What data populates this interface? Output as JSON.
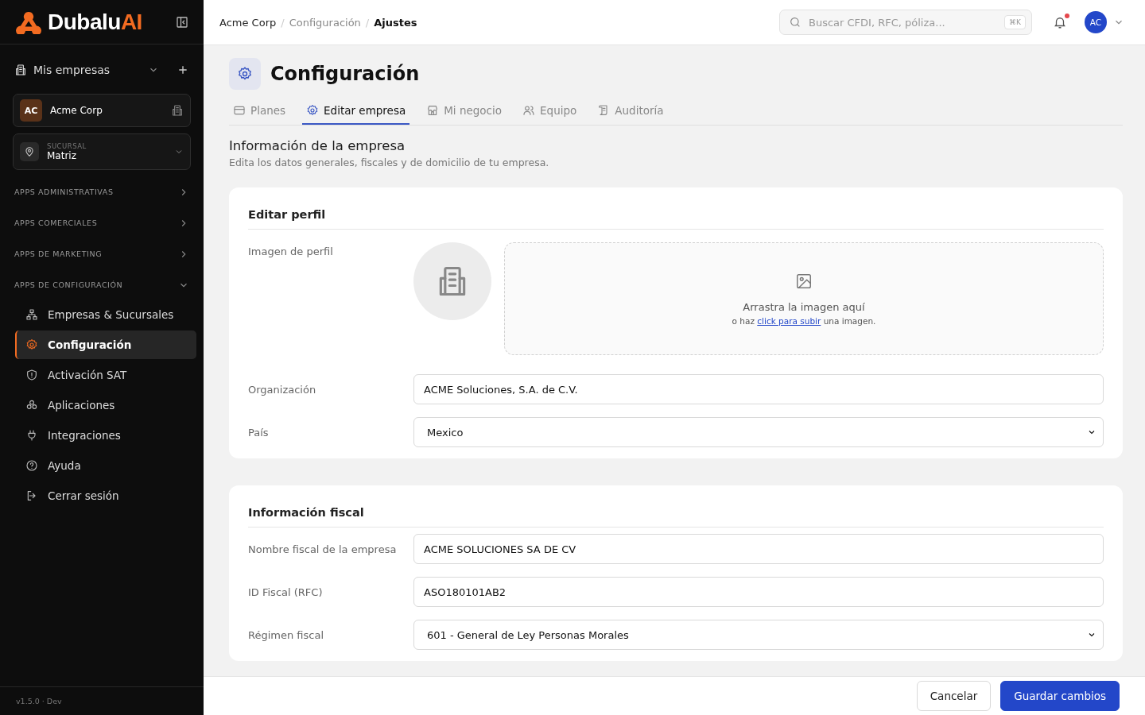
{
  "brand": {
    "name": "Dubalu",
    "accent": "AI"
  },
  "sidebar": {
    "companies_label": "Mis empresas",
    "company": {
      "initials": "AC",
      "name": "Acme Corp"
    },
    "branch": {
      "label": "SUCURSAL",
      "value": "Matriz"
    },
    "sections": [
      {
        "label": "APPS ADMINISTRATIVAS",
        "expanded": false
      },
      {
        "label": "APPS COMERCIALES",
        "expanded": false
      },
      {
        "label": "APPS DE MARKETING",
        "expanded": false
      },
      {
        "label": "APPS DE CONFIGURACIÓN",
        "expanded": true,
        "items": [
          {
            "label": "Empresas & Sucursales",
            "selected": false
          },
          {
            "label": "Configuración",
            "selected": true
          },
          {
            "label": "Activación SAT",
            "selected": false
          },
          {
            "label": "Aplicaciones",
            "selected": false
          },
          {
            "label": "Integraciones",
            "selected": false
          },
          {
            "label": "Ayuda",
            "selected": false
          },
          {
            "label": "Cerrar sesión",
            "selected": false
          }
        ]
      }
    ],
    "version": "v1.5.0 · Dev"
  },
  "breadcrumb": [
    {
      "label": "Acme Corp",
      "current": false
    },
    {
      "separator": "/"
    },
    {
      "label": "Configuración",
      "current": false
    },
    {
      "separator": "/"
    },
    {
      "label": "Ajustes",
      "current": true
    }
  ],
  "search": {
    "placeholder": "Buscar CFDI, RFC, póliza...",
    "shortcut": "⌘K"
  },
  "notifications": {
    "unread": true
  },
  "user": {
    "initials": "AC"
  },
  "page_title": "Configuración",
  "tabs": [
    {
      "label": "Planes",
      "selected": false
    },
    {
      "label": "Editar empresa",
      "selected": true
    },
    {
      "label": "Mi negocio",
      "selected": false
    },
    {
      "label": "Equipo",
      "selected": false
    },
    {
      "label": "Auditoría",
      "selected": false
    }
  ],
  "section": {
    "title": "Información de la empresa",
    "subtitle": "Edita los datos generales, fiscales y de domicilio de tu empresa."
  },
  "cards": [
    {
      "title": "Editar perfil",
      "image_label": "Imagen de perfil",
      "dropzone": {
        "title": "Arrastra la imagen aquí",
        "before": "o haz",
        "link": "click para subir",
        "after": "una imagen."
      },
      "fields": [
        {
          "label": "Organización",
          "kind": "text",
          "value": "ACME Soluciones, S.A. de C.V."
        },
        {
          "label": "País",
          "kind": "select",
          "value": "Mexico"
        }
      ]
    },
    {
      "title": "Información fiscal",
      "fields": [
        {
          "label": "Nombre fiscal de la empresa",
          "kind": "text",
          "value": "ACME SOLUCIONES SA DE CV"
        },
        {
          "label": "ID Fiscal (RFC)",
          "kind": "text",
          "value": "ASO180101AB2"
        },
        {
          "label": "Régimen fiscal",
          "kind": "select",
          "value": "601 - General de Ley Personas Morales"
        }
      ]
    }
  ],
  "footer": {
    "cancel": "Cancelar",
    "save": "Guardar cambios"
  }
}
